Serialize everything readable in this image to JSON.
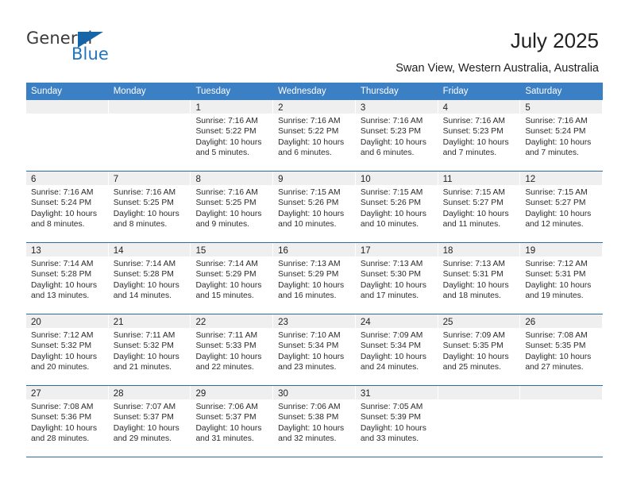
{
  "brand": {
    "name_part1": "General",
    "name_part2": "Blue"
  },
  "header": {
    "title": "July 2025",
    "subtitle": "Swan View, Western Australia, Australia"
  },
  "calendar": {
    "weekdays": [
      "Sunday",
      "Monday",
      "Tuesday",
      "Wednesday",
      "Thursday",
      "Friday",
      "Saturday"
    ],
    "weeks": [
      [
        {
          "day": "",
          "sunrise": "",
          "sunset": "",
          "daylight1": "",
          "daylight2": ""
        },
        {
          "day": "",
          "sunrise": "",
          "sunset": "",
          "daylight1": "",
          "daylight2": ""
        },
        {
          "day": "1",
          "sunrise": "Sunrise: 7:16 AM",
          "sunset": "Sunset: 5:22 PM",
          "daylight1": "Daylight: 10 hours",
          "daylight2": "and 5 minutes."
        },
        {
          "day": "2",
          "sunrise": "Sunrise: 7:16 AM",
          "sunset": "Sunset: 5:22 PM",
          "daylight1": "Daylight: 10 hours",
          "daylight2": "and 6 minutes."
        },
        {
          "day": "3",
          "sunrise": "Sunrise: 7:16 AM",
          "sunset": "Sunset: 5:23 PM",
          "daylight1": "Daylight: 10 hours",
          "daylight2": "and 6 minutes."
        },
        {
          "day": "4",
          "sunrise": "Sunrise: 7:16 AM",
          "sunset": "Sunset: 5:23 PM",
          "daylight1": "Daylight: 10 hours",
          "daylight2": "and 7 minutes."
        },
        {
          "day": "5",
          "sunrise": "Sunrise: 7:16 AM",
          "sunset": "Sunset: 5:24 PM",
          "daylight1": "Daylight: 10 hours",
          "daylight2": "and 7 minutes."
        }
      ],
      [
        {
          "day": "6",
          "sunrise": "Sunrise: 7:16 AM",
          "sunset": "Sunset: 5:24 PM",
          "daylight1": "Daylight: 10 hours",
          "daylight2": "and 8 minutes."
        },
        {
          "day": "7",
          "sunrise": "Sunrise: 7:16 AM",
          "sunset": "Sunset: 5:25 PM",
          "daylight1": "Daylight: 10 hours",
          "daylight2": "and 8 minutes."
        },
        {
          "day": "8",
          "sunrise": "Sunrise: 7:16 AM",
          "sunset": "Sunset: 5:25 PM",
          "daylight1": "Daylight: 10 hours",
          "daylight2": "and 9 minutes."
        },
        {
          "day": "9",
          "sunrise": "Sunrise: 7:15 AM",
          "sunset": "Sunset: 5:26 PM",
          "daylight1": "Daylight: 10 hours",
          "daylight2": "and 10 minutes."
        },
        {
          "day": "10",
          "sunrise": "Sunrise: 7:15 AM",
          "sunset": "Sunset: 5:26 PM",
          "daylight1": "Daylight: 10 hours",
          "daylight2": "and 10 minutes."
        },
        {
          "day": "11",
          "sunrise": "Sunrise: 7:15 AM",
          "sunset": "Sunset: 5:27 PM",
          "daylight1": "Daylight: 10 hours",
          "daylight2": "and 11 minutes."
        },
        {
          "day": "12",
          "sunrise": "Sunrise: 7:15 AM",
          "sunset": "Sunset: 5:27 PM",
          "daylight1": "Daylight: 10 hours",
          "daylight2": "and 12 minutes."
        }
      ],
      [
        {
          "day": "13",
          "sunrise": "Sunrise: 7:14 AM",
          "sunset": "Sunset: 5:28 PM",
          "daylight1": "Daylight: 10 hours",
          "daylight2": "and 13 minutes."
        },
        {
          "day": "14",
          "sunrise": "Sunrise: 7:14 AM",
          "sunset": "Sunset: 5:28 PM",
          "daylight1": "Daylight: 10 hours",
          "daylight2": "and 14 minutes."
        },
        {
          "day": "15",
          "sunrise": "Sunrise: 7:14 AM",
          "sunset": "Sunset: 5:29 PM",
          "daylight1": "Daylight: 10 hours",
          "daylight2": "and 15 minutes."
        },
        {
          "day": "16",
          "sunrise": "Sunrise: 7:13 AM",
          "sunset": "Sunset: 5:29 PM",
          "daylight1": "Daylight: 10 hours",
          "daylight2": "and 16 minutes."
        },
        {
          "day": "17",
          "sunrise": "Sunrise: 7:13 AM",
          "sunset": "Sunset: 5:30 PM",
          "daylight1": "Daylight: 10 hours",
          "daylight2": "and 17 minutes."
        },
        {
          "day": "18",
          "sunrise": "Sunrise: 7:13 AM",
          "sunset": "Sunset: 5:31 PM",
          "daylight1": "Daylight: 10 hours",
          "daylight2": "and 18 minutes."
        },
        {
          "day": "19",
          "sunrise": "Sunrise: 7:12 AM",
          "sunset": "Sunset: 5:31 PM",
          "daylight1": "Daylight: 10 hours",
          "daylight2": "and 19 minutes."
        }
      ],
      [
        {
          "day": "20",
          "sunrise": "Sunrise: 7:12 AM",
          "sunset": "Sunset: 5:32 PM",
          "daylight1": "Daylight: 10 hours",
          "daylight2": "and 20 minutes."
        },
        {
          "day": "21",
          "sunrise": "Sunrise: 7:11 AM",
          "sunset": "Sunset: 5:32 PM",
          "daylight1": "Daylight: 10 hours",
          "daylight2": "and 21 minutes."
        },
        {
          "day": "22",
          "sunrise": "Sunrise: 7:11 AM",
          "sunset": "Sunset: 5:33 PM",
          "daylight1": "Daylight: 10 hours",
          "daylight2": "and 22 minutes."
        },
        {
          "day": "23",
          "sunrise": "Sunrise: 7:10 AM",
          "sunset": "Sunset: 5:34 PM",
          "daylight1": "Daylight: 10 hours",
          "daylight2": "and 23 minutes."
        },
        {
          "day": "24",
          "sunrise": "Sunrise: 7:09 AM",
          "sunset": "Sunset: 5:34 PM",
          "daylight1": "Daylight: 10 hours",
          "daylight2": "and 24 minutes."
        },
        {
          "day": "25",
          "sunrise": "Sunrise: 7:09 AM",
          "sunset": "Sunset: 5:35 PM",
          "daylight1": "Daylight: 10 hours",
          "daylight2": "and 25 minutes."
        },
        {
          "day": "26",
          "sunrise": "Sunrise: 7:08 AM",
          "sunset": "Sunset: 5:35 PM",
          "daylight1": "Daylight: 10 hours",
          "daylight2": "and 27 minutes."
        }
      ],
      [
        {
          "day": "27",
          "sunrise": "Sunrise: 7:08 AM",
          "sunset": "Sunset: 5:36 PM",
          "daylight1": "Daylight: 10 hours",
          "daylight2": "and 28 minutes."
        },
        {
          "day": "28",
          "sunrise": "Sunrise: 7:07 AM",
          "sunset": "Sunset: 5:37 PM",
          "daylight1": "Daylight: 10 hours",
          "daylight2": "and 29 minutes."
        },
        {
          "day": "29",
          "sunrise": "Sunrise: 7:06 AM",
          "sunset": "Sunset: 5:37 PM",
          "daylight1": "Daylight: 10 hours",
          "daylight2": "and 31 minutes."
        },
        {
          "day": "30",
          "sunrise": "Sunrise: 7:06 AM",
          "sunset": "Sunset: 5:38 PM",
          "daylight1": "Daylight: 10 hours",
          "daylight2": "and 32 minutes."
        },
        {
          "day": "31",
          "sunrise": "Sunrise: 7:05 AM",
          "sunset": "Sunset: 5:39 PM",
          "daylight1": "Daylight: 10 hours",
          "daylight2": "and 33 minutes."
        },
        {
          "day": "",
          "sunrise": "",
          "sunset": "",
          "daylight1": "",
          "daylight2": ""
        },
        {
          "day": "",
          "sunrise": "",
          "sunset": "",
          "daylight1": "",
          "daylight2": ""
        }
      ]
    ]
  },
  "colors": {
    "header_blue": "#3b7fc4",
    "rule_blue": "#2e6da4",
    "daynum_band": "#efefef",
    "brand_blue": "#2175bd"
  }
}
